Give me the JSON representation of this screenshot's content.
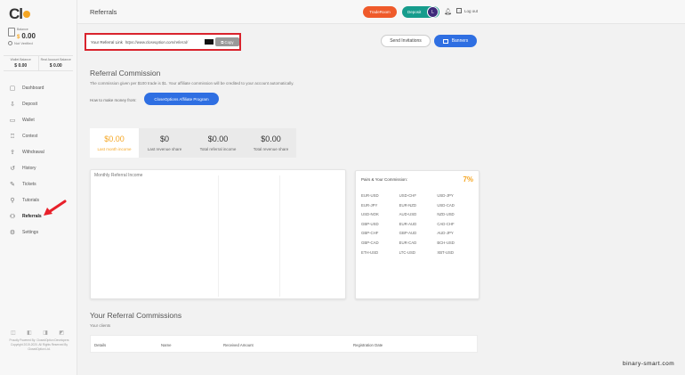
{
  "sidebar": {
    "logo_text": "Cl",
    "balance_label": "Balance",
    "balance_currency": "$",
    "balance_value": "0.00",
    "verification_status": "Not Verified",
    "sub_balances": [
      {
        "label": "Wallet Balance",
        "value": "$ 0.00"
      },
      {
        "label": "Real Account Balance",
        "value": "$ 0.00"
      }
    ],
    "nav_items": [
      {
        "label": "Dashboard",
        "icon": "dashboard-icon"
      },
      {
        "label": "Deposit",
        "icon": "deposit-icon"
      },
      {
        "label": "Wallet",
        "icon": "wallet-icon"
      },
      {
        "label": "Contest",
        "icon": "trophy-icon"
      },
      {
        "label": "Withdrawal",
        "icon": "withdraw-icon"
      },
      {
        "label": "History",
        "icon": "history-icon"
      },
      {
        "label": "Tickets",
        "icon": "ticket-icon"
      },
      {
        "label": "Tutorials",
        "icon": "tutorials-icon"
      },
      {
        "label": "Referrals",
        "icon": "referrals-icon"
      },
      {
        "label": "Settings",
        "icon": "settings-icon"
      }
    ],
    "footer_text": "Proudly Powered By: ClosedOption Developers Copyright 2019-2020. All Rights Reserved By ClosedOption Ltd."
  },
  "header": {
    "title": "Referrals",
    "traderoom_label": "TradeRoom",
    "deposit_label": "Deposit",
    "avatar_initial": "L",
    "logout_label": "Log out"
  },
  "referral_link": {
    "label": "Your Referral Link",
    "value": "https://www.closeoption.com/referral/",
    "copy_label": "Copy"
  },
  "actions": {
    "send_invitations": "Send Invitations",
    "banners": "Banners"
  },
  "commission": {
    "title": "Referral Commission",
    "description": "The commission given per $100 trade is $1. Your affiliate commission will be credited to your account automatically.",
    "howto_label": "How to make money from:",
    "program_button": "CloseOptions Affiliate Program"
  },
  "stats": [
    {
      "value": "$0.00",
      "label": "Last month income"
    },
    {
      "value": "$0",
      "label": "Last revenue share"
    },
    {
      "value": "$0.00",
      "label": "Total referral income"
    },
    {
      "value": "$0.00",
      "label": "Total revenue share"
    }
  ],
  "chart": {
    "title": "Monthly Referral Income"
  },
  "pairs": {
    "title": "Pairs & Your Commission:",
    "percent": "7%",
    "items": [
      "EUR-USD",
      "USD-CHF",
      "USD-JPY",
      "EUR-JPY",
      "EUR-NZD",
      "USD-CAD",
      "USD-NOK",
      "AUD-USD",
      "NZD-USD",
      "GBP-USD",
      "EUR-AUD",
      "CAD-CHF",
      "GBP-CHF",
      "GBP-AUD",
      "AUD-JPY",
      "GBP-CAD",
      "EUR-CAD",
      "BCH-USD",
      "ETH-USD",
      "LTC-USD",
      "XBT-USD"
    ]
  },
  "commissions_table": {
    "title": "Your Referral Commissions",
    "subtitle": "Your clients",
    "columns": [
      "Details",
      "Name",
      "Received Amount",
      "Registration Date"
    ]
  },
  "watermark": "binary-smart.com"
}
